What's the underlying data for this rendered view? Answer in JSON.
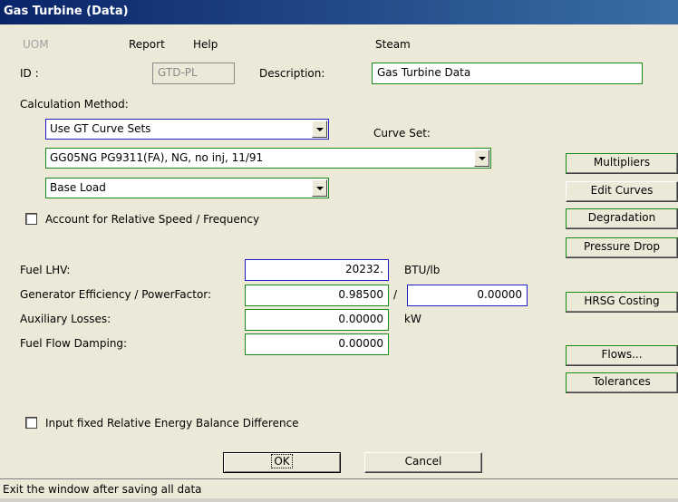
{
  "window": {
    "title": "Gas Turbine (Data)"
  },
  "menu": {
    "uom": "UOM",
    "report": "Report",
    "help": "Help",
    "steam": "Steam"
  },
  "id": {
    "label": "ID :",
    "value": "GTD-PL"
  },
  "description": {
    "label": "Description:",
    "value": "Gas Turbine Data"
  },
  "calc": {
    "label": "Calculation Method:",
    "method": "Use GT Curve Sets",
    "curve_set_label": "Curve Set:",
    "curve_set": "GG05NG  PG9311(FA), NG, no inj, 11/91",
    "load": "Base Load"
  },
  "checkbox_speed": {
    "label": "Account for Relative Speed / Frequency",
    "checked": false
  },
  "fuel_lhv": {
    "label": "Fuel LHV:",
    "value": "20232.",
    "unit": "BTU/lb"
  },
  "gen_eff": {
    "label": "Generator Efficiency / PowerFactor:",
    "value": "0.98500",
    "separator": "/",
    "value2": "0.00000"
  },
  "aux": {
    "label": "Auxiliary Losses:",
    "value": "0.00000",
    "unit": "kW"
  },
  "fuel_flow": {
    "label": "Fuel Flow Damping:",
    "value": "0.00000"
  },
  "checkbox_energy": {
    "label": "Input fixed Relative Energy Balance Difference",
    "checked": false
  },
  "side_buttons": {
    "multipliers": "Multipliers",
    "edit_curves": "Edit Curves",
    "degradation": "Degradation",
    "pressure_drop": "Pressure Drop",
    "hrsg_costing": "HRSG Costing",
    "flows": "Flows...",
    "tolerances": "Tolerances"
  },
  "dialog_buttons": {
    "ok": "OK",
    "cancel": "Cancel"
  },
  "status": {
    "text": "Exit the window after saving all data"
  },
  "colors": {
    "title_bar": "#0a246a",
    "panel": "#ece9d8",
    "field_border_green": "#148c14",
    "field_border_blue": "#1e1ec8"
  }
}
